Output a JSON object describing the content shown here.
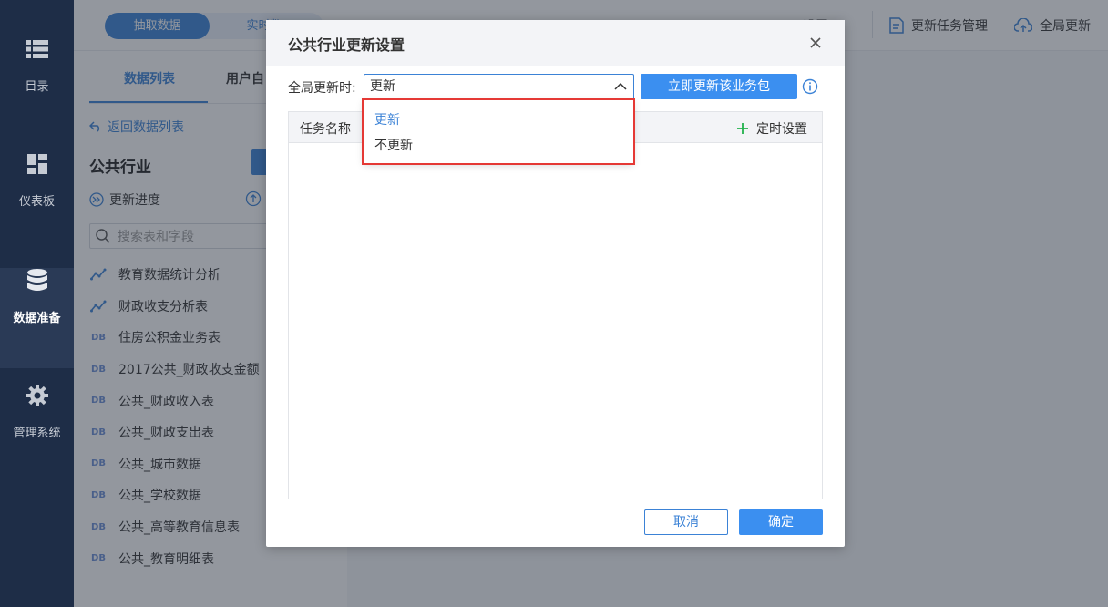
{
  "nav": {
    "items": [
      {
        "label": "目录",
        "icon": "list-icon"
      },
      {
        "label": "仪表板",
        "icon": "dashboard-icon"
      },
      {
        "label": "数据准备",
        "icon": "database-icon",
        "active": true
      },
      {
        "label": "管理系统",
        "icon": "gear-icon"
      }
    ]
  },
  "topbar": {
    "tabs": [
      "抽取数据",
      "实时数"
    ],
    "actions": [
      "(obscured)",
      "设置",
      "更新任务管理",
      "全局更新"
    ]
  },
  "panel": {
    "tabs": [
      "数据列表",
      "用户自"
    ],
    "back_label": "返回数据列表",
    "package_title": "公共行业",
    "progress_label": "更新进度",
    "search_placeholder": "搜索表和字段",
    "tables": [
      {
        "icon": "analysis-icon",
        "name": "教育数据统计分析"
      },
      {
        "icon": "analysis-icon",
        "name": "财政收支分析表"
      },
      {
        "icon": "db-icon",
        "name": "住房公积金业务表"
      },
      {
        "icon": "db-icon",
        "name": "2017公共_财政收支金额"
      },
      {
        "icon": "db-icon",
        "name": "公共_财政收入表"
      },
      {
        "icon": "db-icon",
        "name": "公共_财政支出表"
      },
      {
        "icon": "db-icon",
        "name": "公共_城市数据"
      },
      {
        "icon": "db-icon",
        "name": "公共_学校数据"
      },
      {
        "icon": "db-icon",
        "name": "公共_高等教育信息表"
      },
      {
        "icon": "db-icon",
        "name": "公共_教育明细表"
      }
    ]
  },
  "dialog": {
    "title": "公共行业更新设置",
    "global_label": "全局更新时:",
    "select_value": "更新",
    "update_now_button": "立即更新该业务包",
    "table_header_name": "任务名称",
    "table_header_schedule": "定时设置",
    "cancel": "取消",
    "ok": "确定",
    "menu_options": [
      "更新",
      "不更新"
    ]
  },
  "colors": {
    "accent": "#3b82d6",
    "highlight": "#e53935",
    "nav_bg": "#1e2d47"
  }
}
